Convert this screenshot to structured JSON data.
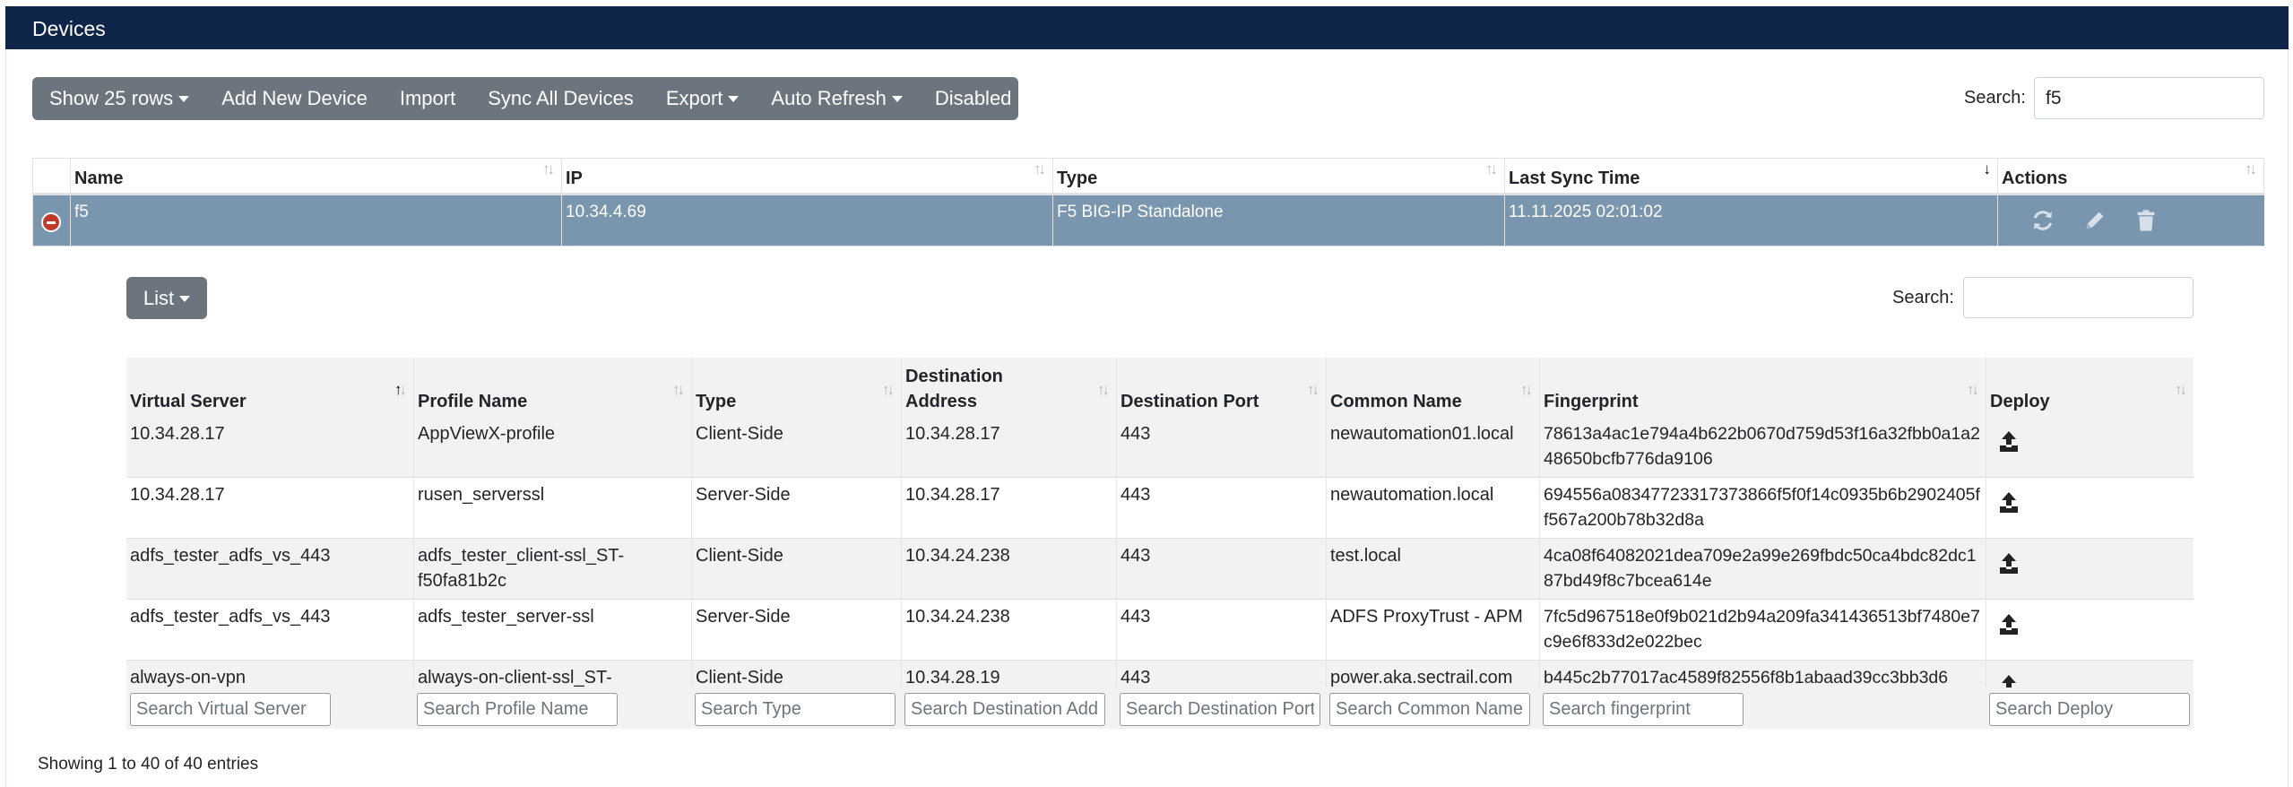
{
  "header": {
    "title": "Devices"
  },
  "toolbar": {
    "show_rows": "Show 25 rows",
    "add_device": "Add New Device",
    "import": "Import",
    "sync_all": "Sync All Devices",
    "export": "Export",
    "auto_refresh": "Auto Refresh",
    "disabled": "Disabled"
  },
  "search": {
    "label": "Search:",
    "value": "f5"
  },
  "devices": {
    "columns": [
      "Name",
      "IP",
      "Type",
      "Last Sync Time",
      "Actions"
    ],
    "row": {
      "name": "f5",
      "ip": "10.34.4.69",
      "type": "F5 BIG-IP Standalone",
      "last_sync": "11.11.2025 02:01:02"
    }
  },
  "child": {
    "list_button": "List",
    "search_label": "Search:",
    "search_value": "",
    "columns": {
      "virtual_server": "Virtual Server",
      "profile_name": "Profile Name",
      "type": "Type",
      "destination_address": "Destination Address",
      "destination_port": "Destination Port",
      "common_name": "Common Name",
      "fingerprint": "Fingerprint",
      "deploy": "Deploy"
    },
    "rows": [
      {
        "vs": "10.34.28.17",
        "profile": "AppViewX-profile",
        "type": "Client-Side",
        "addr": "10.34.28.17",
        "port": "443",
        "cn": "newautomation01.local",
        "fp": "78613a4ac1e794a4b622b0670d759d53f16a32fbb0a1a248650bcfb776da9106"
      },
      {
        "vs": "10.34.28.17",
        "profile": "rusen_serverssl",
        "type": "Server-Side",
        "addr": "10.34.28.17",
        "port": "443",
        "cn": "newautomation.local",
        "fp": "694556a08347723317373866f5f0f14c0935b6b2902405ff567a200b78b32d8a"
      },
      {
        "vs": "adfs_tester_adfs_vs_443",
        "profile": "adfs_tester_client-ssl_ST-f50fa81b2c",
        "type": "Client-Side",
        "addr": "10.34.24.238",
        "port": "443",
        "cn": "test.local",
        "fp": "4ca08f64082021dea709e2a99e269fbdc50ca4bdc82dc187bd49f8c7bcea614e"
      },
      {
        "vs": "adfs_tester_adfs_vs_443",
        "profile": "adfs_tester_server-ssl",
        "type": "Server-Side",
        "addr": "10.34.24.238",
        "port": "443",
        "cn": "ADFS ProxyTrust - APM",
        "fp": "7fc5d967518e0f9b021d2b94a209fa341436513bf7480e7c9e6f833d2e022bec"
      },
      {
        "vs": "always-on-vpn",
        "profile": "always-on-client-ssl_ST-",
        "type": "Client-Side",
        "addr": "10.34.28.19",
        "port": "443",
        "cn": "power.aka.sectrail.com",
        "fp": "b445c2b77017ac4589f82556f8b1abaad39cc3bb3d6"
      }
    ],
    "filters": {
      "virtual_server": "Search Virtual Server",
      "profile_name": "Search Profile Name",
      "type": "Search Type",
      "destination_address": "Search Destination Address",
      "destination_port": "Search Destination Port",
      "common_name": "Search Common Name",
      "fingerprint": "Search fingerprint",
      "deploy": "Search Deploy"
    }
  },
  "info": "Showing 1 to 40 of 40 entries"
}
